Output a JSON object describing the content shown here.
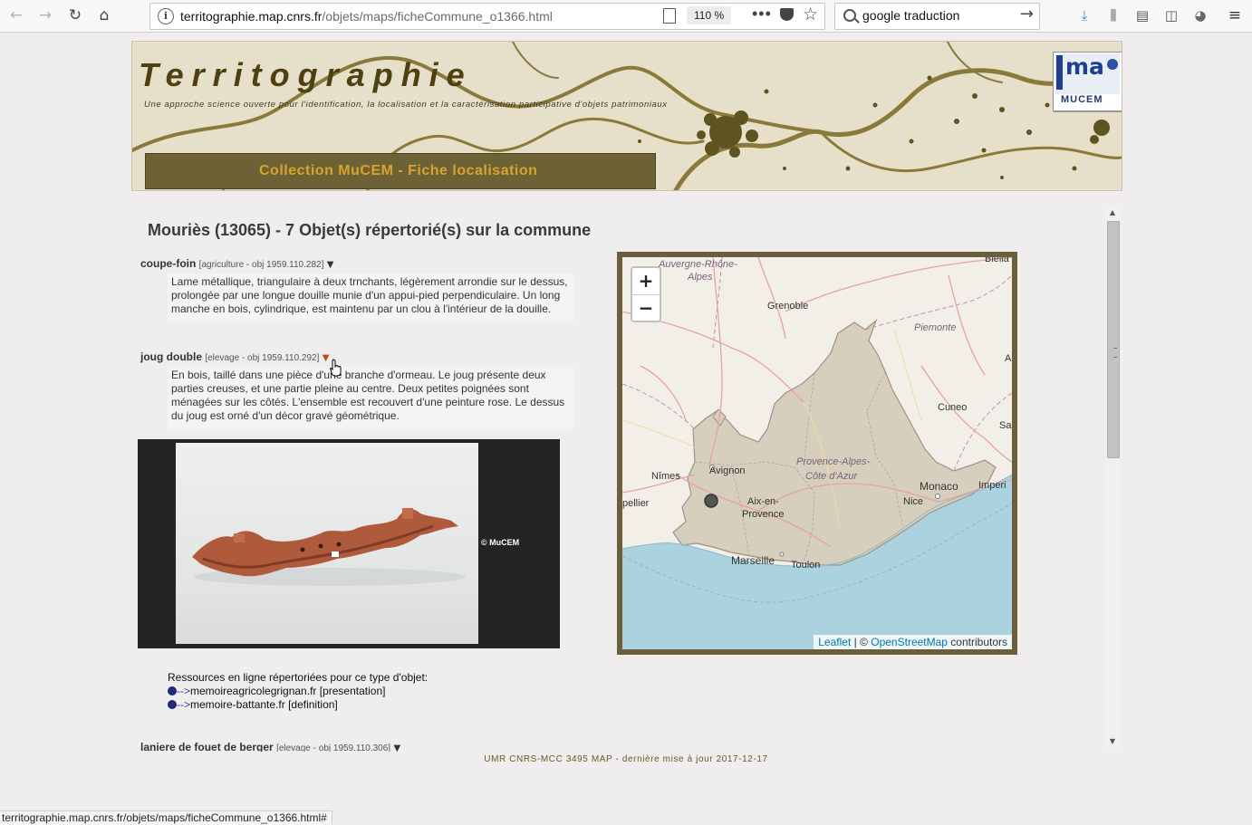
{
  "browser": {
    "url_domain": "territographie.map.cnrs.fr",
    "url_path": "/objets/maps/ficheCommune_o1366.html",
    "zoom_level": "110 %",
    "search_value": "google traduction",
    "status_url": "territographie.map.cnrs.fr/objets/maps/ficheCommune_o1366.html#"
  },
  "header": {
    "site_title": "Territographie",
    "subtitle": "Une approche science ouverte pour l'identification, la localisation et la caractérisation participative d'objets patrimoniaux",
    "collection_label": "Collection MuCEM - Fiche localisation",
    "logo_map_text": "ma",
    "logo_mucem_text": "MUCEM"
  },
  "page": {
    "commune_title": "Mouriès (13065) - 7 Objet(s) répertorié(s) sur la commune"
  },
  "objects": [
    {
      "name": "coupe-foin",
      "meta": "[agriculture - obj 1959.110.282]",
      "arrow": "▼",
      "description": "Lame métallique, triangulaire à deux trnchants, légèrement arrondie sur le dessus, prolongée par une longue douille munie d'un appui-pied perpendiculaire. Un long manche en bois, cylindrique, est maintenu par un clou à l'intérieur de la douille."
    },
    {
      "name": "joug double",
      "meta": "[elevage - obj 1959.110.292]",
      "arrow": "▼",
      "description": "En bois, taillé dans une pièce d'une branche d'ormeau. Le joug présente deux parties creuses, et une partie pleine au centre. Deux petites poignées sont ménagées sur les côtés. L'ensemble est recouvert d'une peinture rose. Le dessus du joug est orné d'un décor gravé géométrique.",
      "photo_copyright": "© MuCEM"
    },
    {
      "name": "laniere de fouet de berger",
      "meta": "[elevage - obj 1959.110.306]",
      "arrow": "▼"
    }
  ],
  "resources": {
    "heading": "Ressources en ligne répertoriées pour ce type d'objet:",
    "items": [
      {
        "arrow": "-->",
        "site": "memoireagricolegrignan.fr",
        "kind": "[presentation]"
      },
      {
        "arrow": "-->",
        "site": "memoire-battante.fr",
        "kind": "[definition]"
      }
    ]
  },
  "map": {
    "zoom_in": "+",
    "zoom_out": "−",
    "labels": {
      "auvergne1": "Auvergne-Rhône-",
      "auvergne2": "Alpes",
      "grenoble": "Grenoble",
      "piemonte": "Piemonte",
      "cuneo": "Cuneo",
      "nimes": "Nîmes",
      "avignon": "Avignon",
      "region1": "Provence-Alpes-",
      "region2": "Côte d'Azur",
      "monaco": "Monaco",
      "nice": "Nice",
      "aix1": "Aix-en-",
      "aix2": "Provence",
      "marseille": "Marseille",
      "toulon": "Toulon",
      "imperia": "Imperi",
      "bielle": "Biella",
      "sa": "Sa",
      "a": "A",
      "bellier": "pellier"
    },
    "attribution_leaflet": "Leaflet",
    "attribution_sep": " | © ",
    "attribution_osm": "OpenStreetMap",
    "attribution_rest": " contributors"
  },
  "footer": {
    "text": "UMR CNRS-MCC 3495 MAP - dernière mise à jour 2017-12-17"
  },
  "colors": {
    "accent_gold": "#d9a32c",
    "banner_bar": "#6d6235",
    "map_frame": "#6a5f3a",
    "region_fill": "#d7cfbd",
    "sea": "#abd3df"
  }
}
